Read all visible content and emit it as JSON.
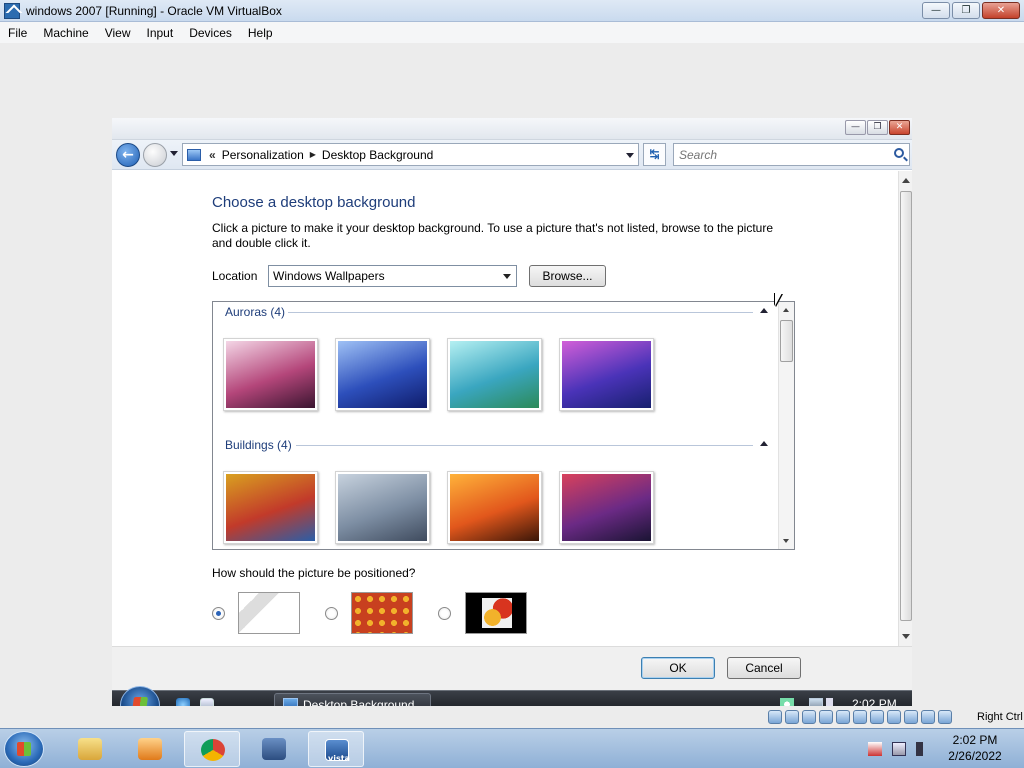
{
  "vbox": {
    "title": "windows 2007 [Running] - Oracle VM VirtualBox",
    "menu": [
      "File",
      "Machine",
      "View",
      "Input",
      "Devices",
      "Help"
    ],
    "window_controls": {
      "minimize": "—",
      "restore": "❐",
      "close": "✕"
    },
    "status_right": "Right Ctrl"
  },
  "guest_window": {
    "controls": {
      "minimize": "—",
      "restore": "❐",
      "close": "✕"
    },
    "nav": {
      "back_label": "←",
      "chevron": "«",
      "breadcrumb": [
        "Personalization",
        "Desktop Background"
      ],
      "separator": "▶",
      "refresh_label": "↹",
      "search_placeholder": "Search"
    },
    "heading": "Choose a desktop background",
    "description": "Click a picture to make it your desktop background. To use a picture that's not listed, browse to the picture and double click it.",
    "location_label": "Location",
    "location_value": "Windows Wallpapers",
    "browse_label": "Browse...",
    "groups": [
      {
        "title": "Auroras (4)",
        "thumbs": [
          {
            "name": "aurora-1",
            "colors": [
              "#f4d6e6",
              "#b4467a",
              "#3a1530"
            ]
          },
          {
            "name": "aurora-2",
            "colors": [
              "#9fc1f5",
              "#2d4fbb",
              "#0f1c6a"
            ]
          },
          {
            "name": "aurora-3",
            "colors": [
              "#b5f0f2",
              "#3aa6c0",
              "#2c8a58"
            ]
          },
          {
            "name": "aurora-4",
            "colors": [
              "#d25fd8",
              "#4a33b8",
              "#17206e"
            ]
          }
        ]
      },
      {
        "title": "Buildings (4)",
        "thumbs": [
          {
            "name": "building-1",
            "colors": [
              "#d9a020",
              "#c23a2a",
              "#2a5ea8"
            ]
          },
          {
            "name": "building-2",
            "colors": [
              "#c7d2de",
              "#7d8ea3",
              "#3f4b5e"
            ]
          },
          {
            "name": "building-3",
            "colors": [
              "#ffb23a",
              "#e2571c",
              "#3a1608"
            ]
          },
          {
            "name": "building-4",
            "colors": [
              "#d8415c",
              "#6b2a85",
              "#1a1433"
            ]
          }
        ]
      }
    ],
    "position_label": "How should the picture be positioned?",
    "ok_label": "OK",
    "cancel_label": "Cancel"
  },
  "guest_taskbar": {
    "task_label": "Desktop Background",
    "clock": "2:02 PM"
  },
  "host_taskbar": {
    "time": "2:02 PM",
    "date": "2/26/2022",
    "vista_label": "vista"
  },
  "colors": {
    "heading": "#1e3d7a",
    "accent": "#2b63b8"
  }
}
